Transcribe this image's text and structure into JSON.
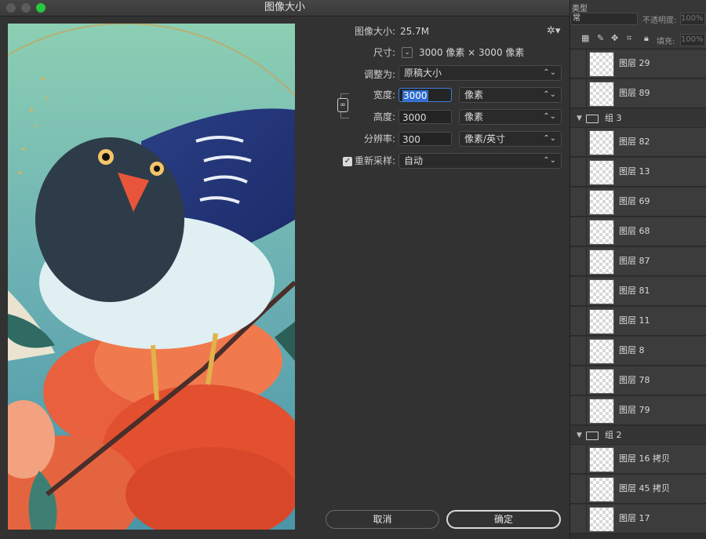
{
  "window": {
    "title": "图像大小"
  },
  "info": {
    "size_label": "图像大小:",
    "size_value": "25.7M",
    "dims_label": "尺寸:",
    "dims_value": "3000 像素  ×  3000 像素"
  },
  "fit": {
    "label": "调整为:",
    "value": "原稿大小"
  },
  "width": {
    "label": "宽度:",
    "value": "3000",
    "unit": "像素"
  },
  "height": {
    "label": "高度:",
    "value": "3000",
    "unit": "像素"
  },
  "resolution": {
    "label": "分辨率:",
    "value": "300",
    "unit": "像素/英寸"
  },
  "resample": {
    "label": "重新采样:",
    "checked": true,
    "value": "自动"
  },
  "buttons": {
    "cancel": "取消",
    "ok": "确定"
  },
  "panel_top": {
    "mode": "常",
    "opacity_label": "不透明度:",
    "opacity": "100%",
    "fill_label": "填充:",
    "fill": "100%",
    "kind": "类型"
  },
  "layers": [
    {
      "type": "layer",
      "name": "图层 29"
    },
    {
      "type": "layer",
      "name": "图层 89"
    },
    {
      "type": "group",
      "name": "组 3"
    },
    {
      "type": "layer",
      "name": "图层 82"
    },
    {
      "type": "layer",
      "name": "图层 13"
    },
    {
      "type": "layer",
      "name": "图层 69"
    },
    {
      "type": "layer",
      "name": "图层 68"
    },
    {
      "type": "layer",
      "name": "图层 87"
    },
    {
      "type": "layer",
      "name": "图层 81"
    },
    {
      "type": "layer",
      "name": "图层 11"
    },
    {
      "type": "layer",
      "name": "图层 8"
    },
    {
      "type": "layer",
      "name": "图层 78"
    },
    {
      "type": "layer",
      "name": "图层 79"
    },
    {
      "type": "group",
      "name": "组 2"
    },
    {
      "type": "layer",
      "name": "图层 16 拷贝"
    },
    {
      "type": "layer",
      "name": "图层 45 拷贝"
    },
    {
      "type": "layer",
      "name": "图层 17"
    }
  ],
  "colors": {
    "accent": "#3e7fd6",
    "dialog_bg": "#323232"
  }
}
